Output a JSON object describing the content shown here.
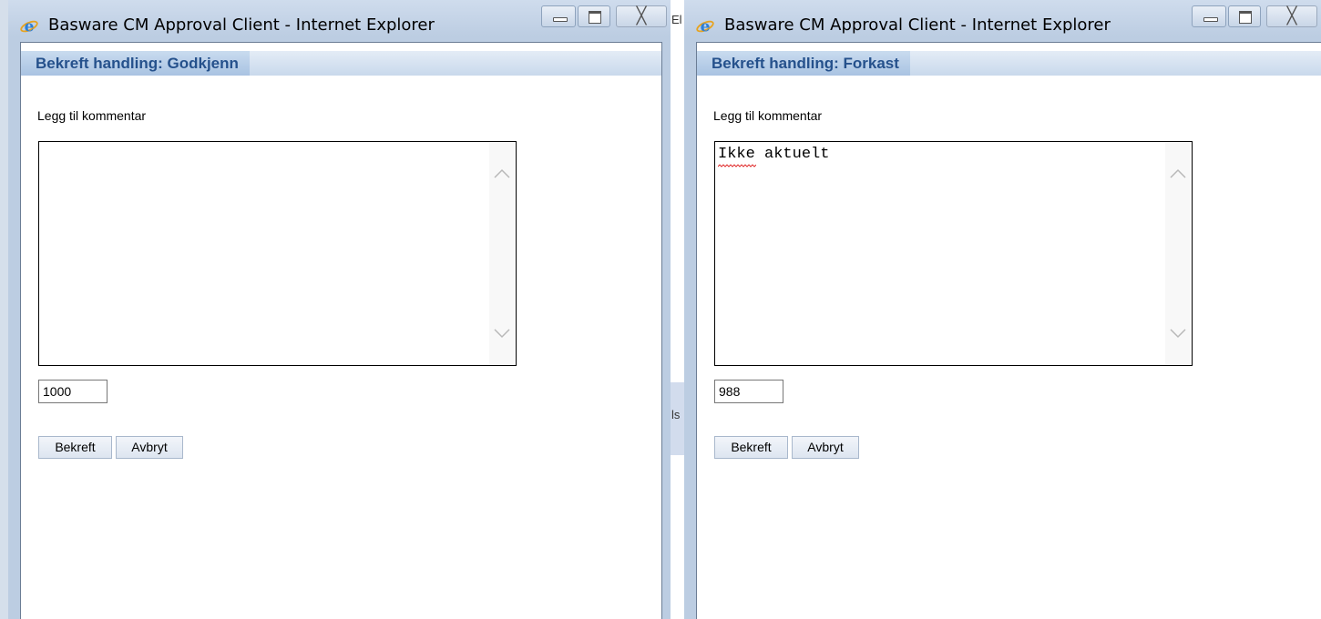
{
  "windows": [
    {
      "title": "Basware CM Approval Client - Internet Explorer",
      "header": "Bekreft handling: Godkjenn",
      "comment_label": "Legg til kommentar",
      "comment_text": "",
      "char_counter": "1000",
      "confirm_label": "Bekreft",
      "cancel_label": "Avbryt",
      "close_glyph": "╳"
    },
    {
      "title": "Basware CM Approval Client - Internet Explorer",
      "header": "Bekreft handling: Forkast",
      "comment_label": "Legg til kommentar",
      "comment_text": "Ikke aktuelt",
      "char_counter": "988",
      "confirm_label": "Bekreft",
      "cancel_label": "Avbryt",
      "close_glyph": "╳"
    }
  ],
  "background": {
    "peek_top": "El",
    "peek_mid": "ls"
  },
  "icons": [
    "internet-explorer-icon",
    "minimize-icon",
    "maximize-icon",
    "close-icon",
    "scroll-up-icon",
    "scroll-down-icon"
  ],
  "colors": {
    "frame": "#bccde2",
    "header_text": "#25518c",
    "header_tab": "#a9c3e2",
    "spellcheck": "#e03030"
  }
}
